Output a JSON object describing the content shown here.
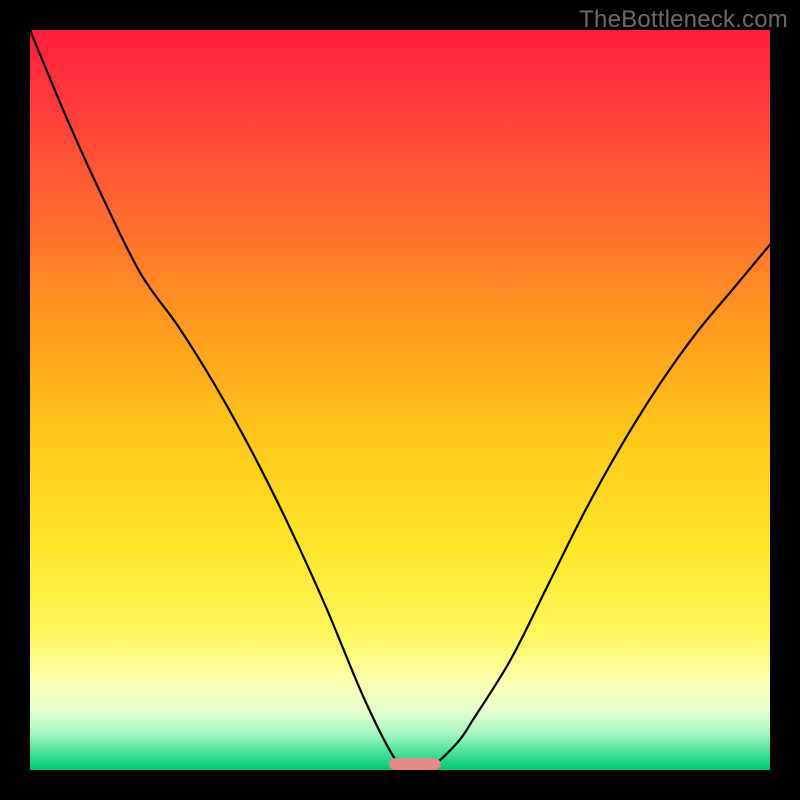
{
  "watermark": {
    "text": "TheBottleneck.com"
  },
  "colors": {
    "black": "#000000",
    "marker_fill": "#e38a86",
    "curve_stroke": "#000000",
    "gradient_stops": [
      {
        "offset": "0%",
        "color": "#ff1e3c"
      },
      {
        "offset": "10%",
        "color": "#ff3b3b"
      },
      {
        "offset": "25%",
        "color": "#ff6a2f"
      },
      {
        "offset": "40%",
        "color": "#ff9a1f"
      },
      {
        "offset": "55%",
        "color": "#ffc81a"
      },
      {
        "offset": "70%",
        "color": "#ffe62a"
      },
      {
        "offset": "82%",
        "color": "#fff85f"
      },
      {
        "offset": "88%",
        "color": "#fbffb0"
      },
      {
        "offset": "92%",
        "color": "#e6ffcf"
      },
      {
        "offset": "95%",
        "color": "#a8f7c1"
      },
      {
        "offset": "97.5%",
        "color": "#4be39a"
      },
      {
        "offset": "100%",
        "color": "#00c972"
      }
    ]
  },
  "chart_data": {
    "type": "line",
    "title": "",
    "xlabel": "",
    "ylabel": "",
    "x": [
      0.0,
      0.05,
      0.1,
      0.15,
      0.2,
      0.25,
      0.3,
      0.35,
      0.4,
      0.45,
      0.49,
      0.51,
      0.53,
      0.55,
      0.58,
      0.6,
      0.65,
      0.7,
      0.75,
      0.8,
      0.85,
      0.9,
      0.95,
      1.0
    ],
    "series": [
      {
        "name": "bottleneck-curve",
        "values": [
          1.0,
          0.88,
          0.77,
          0.67,
          0.6,
          0.52,
          0.43,
          0.33,
          0.22,
          0.1,
          0.02,
          0.0,
          0.0,
          0.01,
          0.04,
          0.07,
          0.15,
          0.25,
          0.35,
          0.44,
          0.52,
          0.59,
          0.65,
          0.71
        ]
      }
    ],
    "xlim": [
      0,
      1
    ],
    "ylim": [
      0,
      1
    ],
    "marker": {
      "x_center": 0.52,
      "x_halfwidth": 0.035,
      "y": 0.008
    }
  }
}
